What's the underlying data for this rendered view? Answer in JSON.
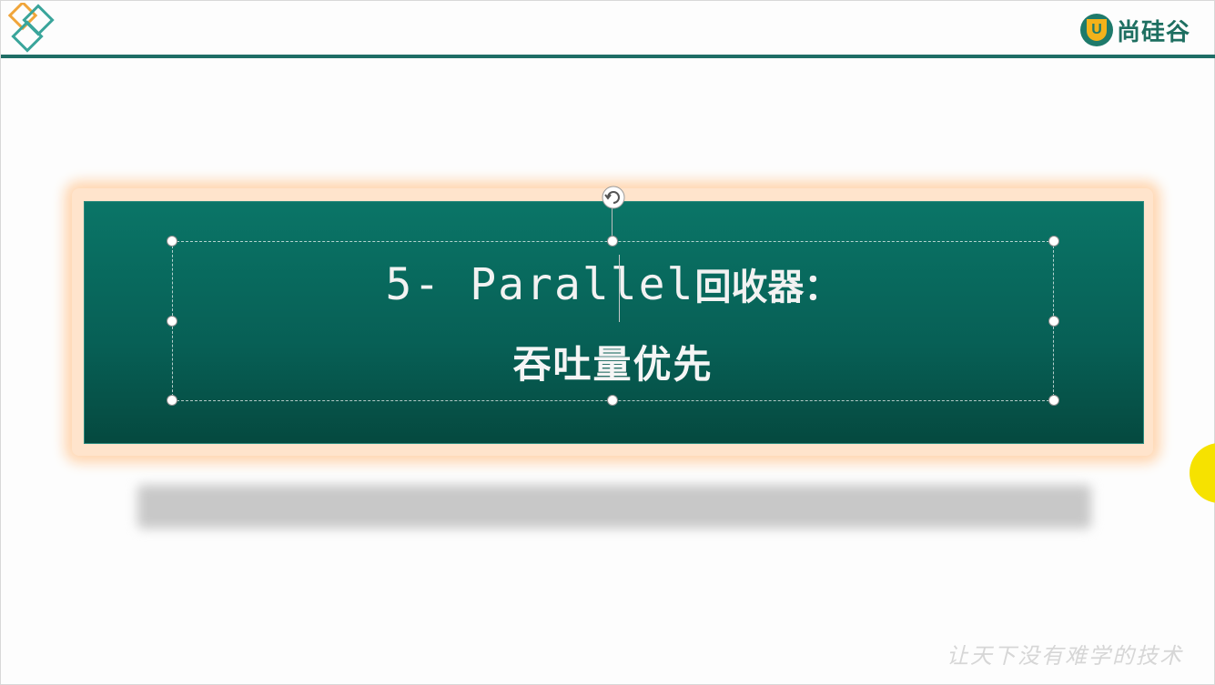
{
  "header": {
    "brand_icon_letter": "U",
    "brand_name": "尚硅谷",
    "colors": {
      "accent": "#1f6e66",
      "brand_yellow": "#f3b21a",
      "logo_orange": "#f0a53a",
      "logo_teal": "#3aa59b"
    }
  },
  "title": {
    "line1_latin": "5- Parallel",
    "line1_cjk": "回收器：",
    "line2": "吞吐量优先",
    "background": "#075f55"
  },
  "footer": {
    "slogan": "让天下没有难学的技术"
  },
  "icons": [
    "diamond-logo-icon",
    "rotate-handle-icon",
    "brand-logo-icon"
  ]
}
